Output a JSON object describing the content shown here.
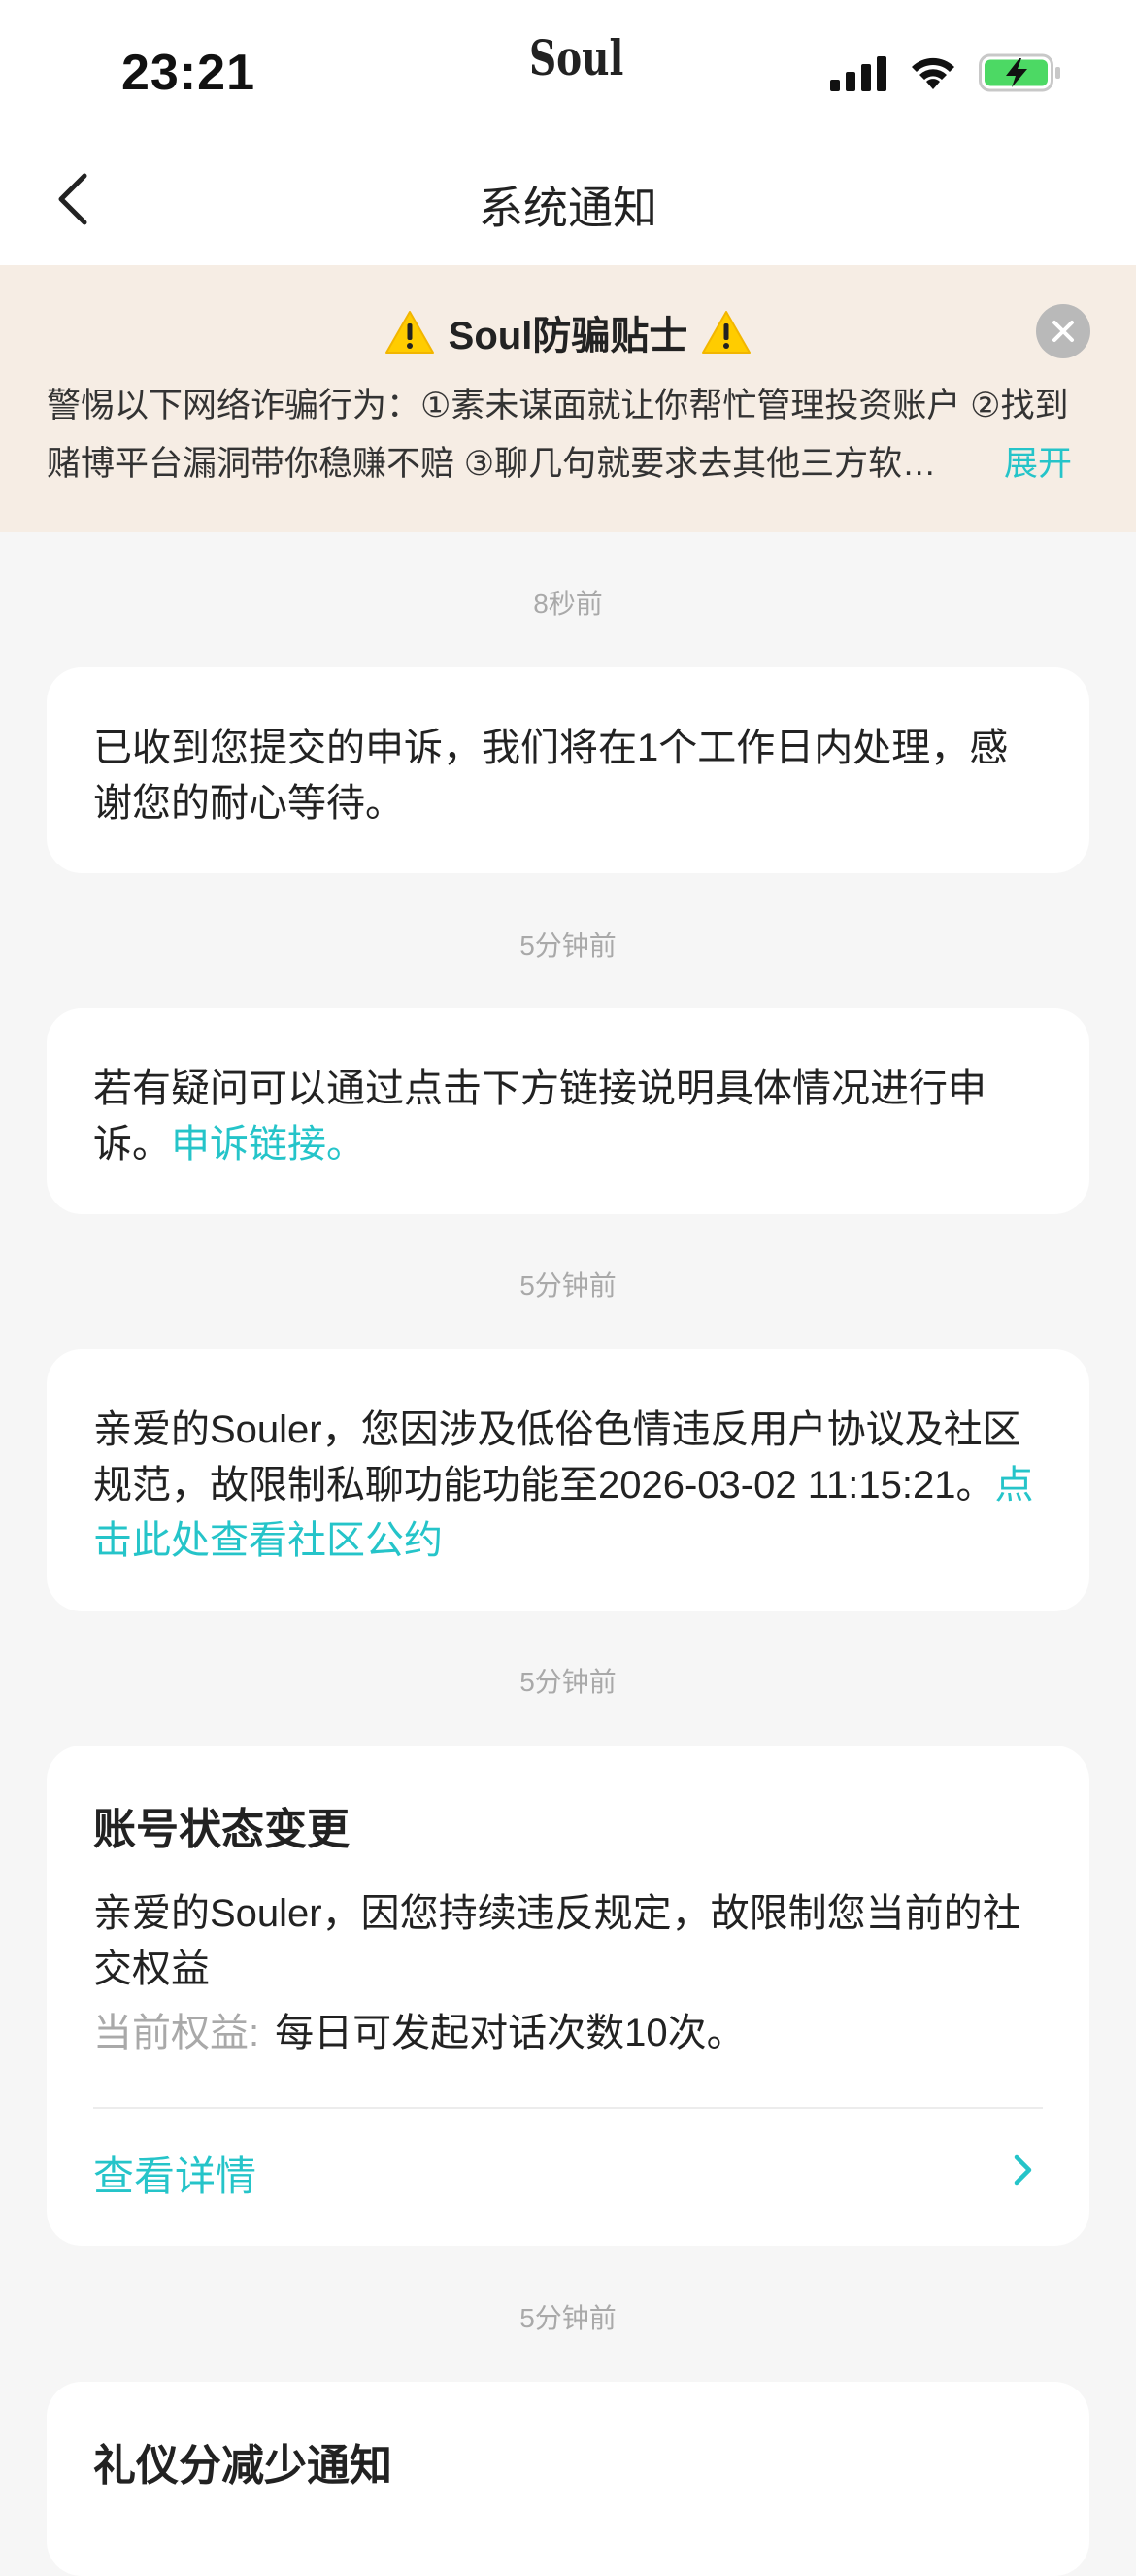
{
  "status_bar": {
    "time": "23:21",
    "app_logo": "Soul"
  },
  "nav": {
    "title": "系统通知"
  },
  "banner": {
    "title": "Soul防骗贴士",
    "text": "警惕以下网络诈骗行为：①素未谋面就让你帮忙管理投资账户 ②找到赌博平台漏洞带你稳赚不赔 ③聊几句就要求去其他三方软…",
    "expand_label": "展开"
  },
  "messages": [
    {
      "time": "8秒前",
      "text": "已收到您提交的申诉，我们将在1个工作日内处理，感谢您的耐心等待。"
    },
    {
      "time": "5分钟前",
      "text": "若有疑问可以通过点击下方链接说明具体情况进行申诉。",
      "link": "申诉链接。"
    },
    {
      "time": "5分钟前",
      "text": "亲爱的Souler，您因涉及低俗色情违反用户协议及社区规范，故限制私聊功能功能至2026-03-02 11:15:21。",
      "link": "点击此处查看社区公约"
    },
    {
      "time": "5分钟前",
      "title": "账号状态变更",
      "text": "亲爱的Souler，因您持续违反规定，故限制您当前的社交权益",
      "benefit_label": "当前权益:",
      "benefit_value": "每日可发起对话次数10次。",
      "details_label": "查看详情"
    },
    {
      "time": "5分钟前",
      "title": "礼仪分减少通知"
    }
  ],
  "colors": {
    "accent": "#25c4c9",
    "background": "#f6f6f6",
    "banner_bg": "#f6ede4",
    "battery": "#4cd964"
  },
  "icons": {
    "back": "chevron-left-icon",
    "close": "close-icon",
    "warning": "warning-icon",
    "details": "chevron-right-icon"
  }
}
